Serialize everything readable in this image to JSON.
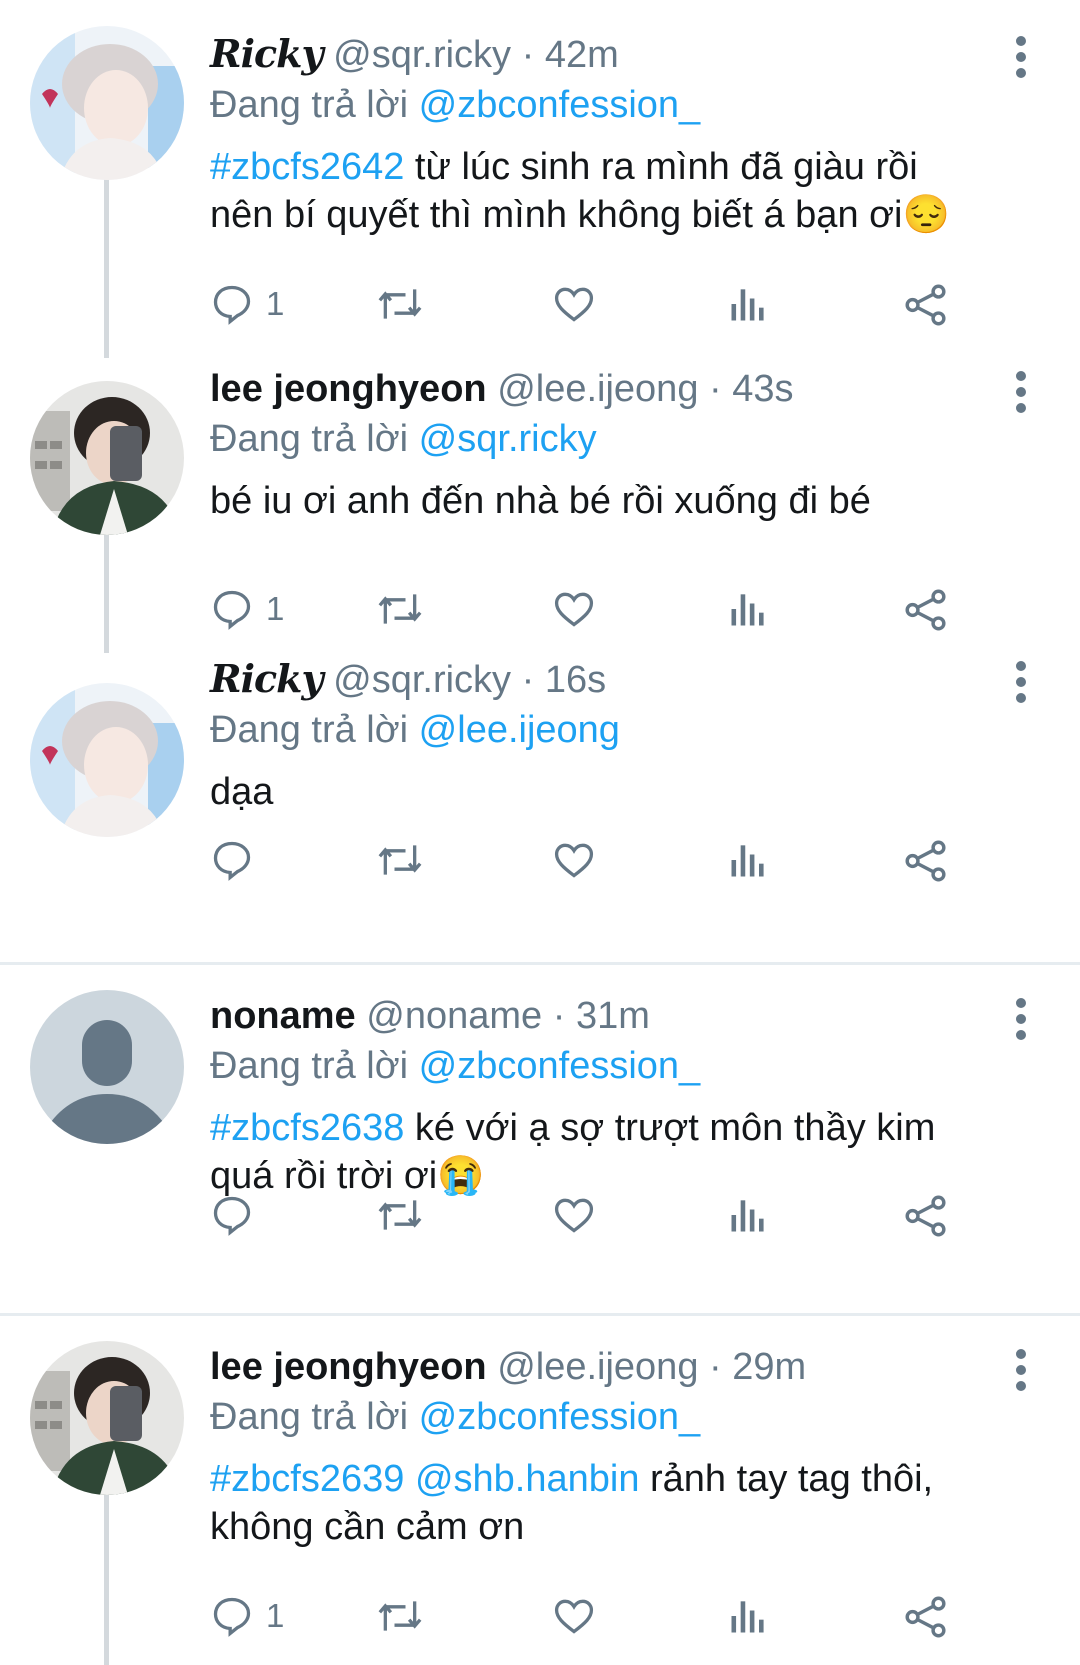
{
  "replying_prefix": "Đang trả lời",
  "tweets": [
    {
      "name": "Ricky",
      "handle": "@sqr.ricky",
      "time": "· 42m",
      "reply_to": "@zbconfession_",
      "hashtag": "#zbcfs2642",
      "text_line1": " từ lúc sinh ra mình đã giàu rồi",
      "text_line2": "nên bí quyết thì mình không biết á bạn ơi",
      "emoji": "😔",
      "reply_count": "1"
    },
    {
      "name": "lee jeonghyeon",
      "handle": "@lee.ijeong",
      "time": "· 43s",
      "reply_to": "@sqr.ricky",
      "text_line1": "bé iu ơi anh đến nhà bé rồi xuống đi bé",
      "reply_count": "1"
    },
    {
      "name": "Ricky",
      "handle": "@sqr.ricky",
      "time": "· 16s",
      "reply_to": "@lee.ijeong",
      "text_line1": "dạa",
      "reply_count": ""
    },
    {
      "name": "noname",
      "handle": "@noname",
      "time": "· 31m",
      "reply_to": "@zbconfession_",
      "hashtag": "#zbcfs2638",
      "text_line1": " ké với ạ sợ trượt môn thầy kim",
      "text_line2": "quá rồi trời ơi",
      "emoji": "😭",
      "reply_count": ""
    },
    {
      "name": "lee jeonghyeon",
      "handle": "@lee.ijeong",
      "time": "· 29m",
      "reply_to": "@zbconfession_",
      "hashtag": "#zbcfs2639",
      "mention_in_text": "@shb.hanbin",
      "text_line1": " rảnh tay tag thôi,",
      "text_line2": "không cần cảm ơn",
      "reply_count": "1"
    }
  ],
  "colors": {
    "accent": "#1da1f2",
    "secondary": "#657786",
    "text": "#14171a",
    "divider": "#e6ecf0"
  },
  "icons": [
    "reply-icon",
    "retweet-icon",
    "like-icon",
    "analytics-icon",
    "share-icon",
    "more-icon"
  ]
}
